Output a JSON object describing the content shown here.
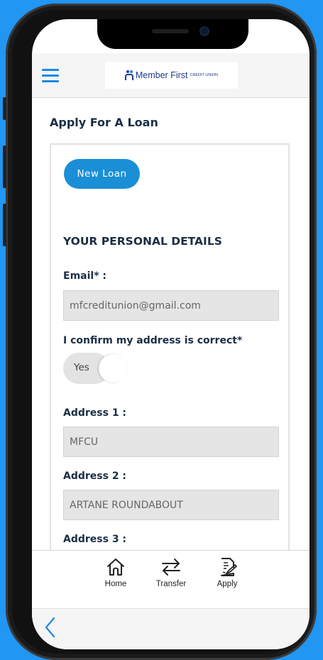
{
  "header": {
    "logo_text": "Member First",
    "logo_sub": "CREDIT UNION"
  },
  "page": {
    "title": "Apply For A Loan"
  },
  "form": {
    "new_loan_button": "New Loan",
    "section_title": "YOUR PERSONAL DETAILS",
    "email_label": "Email* :",
    "email_value": "mfcreditunion@gmail.com",
    "confirm_label": "I confirm my address is correct*",
    "confirm_toggle": "Yes",
    "address1_label": "Address 1 :",
    "address1_value": "MFCU",
    "address2_label": "Address 2 :",
    "address2_value": "ARTANE ROUNDABOUT",
    "address3_label": "Address 3 :"
  },
  "nav": {
    "items": [
      {
        "label": "Home",
        "icon": "home-icon"
      },
      {
        "label": "Transfer",
        "icon": "transfer-icon"
      },
      {
        "label": "Apply",
        "icon": "apply-icon"
      }
    ]
  },
  "colors": {
    "background": "#2196f3",
    "accent": "#1a8fd6",
    "heading": "#1b2e45"
  }
}
